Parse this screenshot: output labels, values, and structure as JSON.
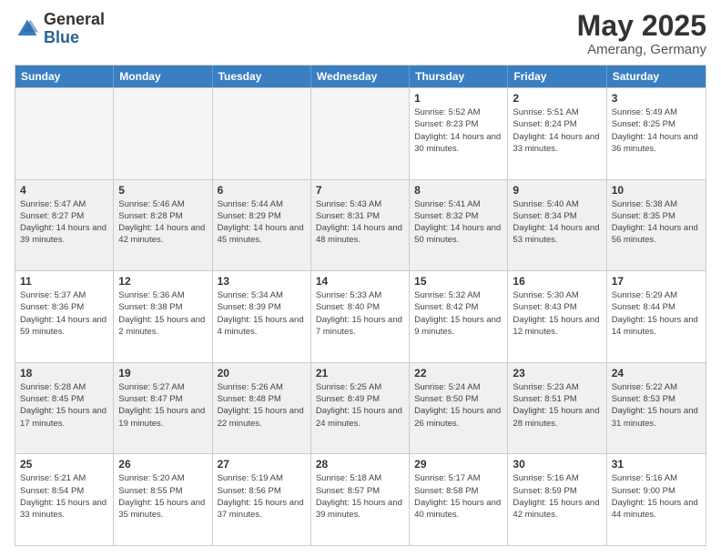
{
  "header": {
    "logo_general": "General",
    "logo_blue": "Blue",
    "month_year": "May 2025",
    "location": "Amerang, Germany"
  },
  "weekdays": [
    "Sunday",
    "Monday",
    "Tuesday",
    "Wednesday",
    "Thursday",
    "Friday",
    "Saturday"
  ],
  "weeks": [
    [
      {
        "day": "",
        "empty": true
      },
      {
        "day": "",
        "empty": true
      },
      {
        "day": "",
        "empty": true
      },
      {
        "day": "",
        "empty": true
      },
      {
        "day": "1",
        "sunrise": "Sunrise: 5:52 AM",
        "sunset": "Sunset: 8:23 PM",
        "daylight": "Daylight: 14 hours and 30 minutes."
      },
      {
        "day": "2",
        "sunrise": "Sunrise: 5:51 AM",
        "sunset": "Sunset: 8:24 PM",
        "daylight": "Daylight: 14 hours and 33 minutes."
      },
      {
        "day": "3",
        "sunrise": "Sunrise: 5:49 AM",
        "sunset": "Sunset: 8:25 PM",
        "daylight": "Daylight: 14 hours and 36 minutes."
      }
    ],
    [
      {
        "day": "4",
        "sunrise": "Sunrise: 5:47 AM",
        "sunset": "Sunset: 8:27 PM",
        "daylight": "Daylight: 14 hours and 39 minutes."
      },
      {
        "day": "5",
        "sunrise": "Sunrise: 5:46 AM",
        "sunset": "Sunset: 8:28 PM",
        "daylight": "Daylight: 14 hours and 42 minutes."
      },
      {
        "day": "6",
        "sunrise": "Sunrise: 5:44 AM",
        "sunset": "Sunset: 8:29 PM",
        "daylight": "Daylight: 14 hours and 45 minutes."
      },
      {
        "day": "7",
        "sunrise": "Sunrise: 5:43 AM",
        "sunset": "Sunset: 8:31 PM",
        "daylight": "Daylight: 14 hours and 48 minutes."
      },
      {
        "day": "8",
        "sunrise": "Sunrise: 5:41 AM",
        "sunset": "Sunset: 8:32 PM",
        "daylight": "Daylight: 14 hours and 50 minutes."
      },
      {
        "day": "9",
        "sunrise": "Sunrise: 5:40 AM",
        "sunset": "Sunset: 8:34 PM",
        "daylight": "Daylight: 14 hours and 53 minutes."
      },
      {
        "day": "10",
        "sunrise": "Sunrise: 5:38 AM",
        "sunset": "Sunset: 8:35 PM",
        "daylight": "Daylight: 14 hours and 56 minutes."
      }
    ],
    [
      {
        "day": "11",
        "sunrise": "Sunrise: 5:37 AM",
        "sunset": "Sunset: 8:36 PM",
        "daylight": "Daylight: 14 hours and 59 minutes."
      },
      {
        "day": "12",
        "sunrise": "Sunrise: 5:36 AM",
        "sunset": "Sunset: 8:38 PM",
        "daylight": "Daylight: 15 hours and 2 minutes."
      },
      {
        "day": "13",
        "sunrise": "Sunrise: 5:34 AM",
        "sunset": "Sunset: 8:39 PM",
        "daylight": "Daylight: 15 hours and 4 minutes."
      },
      {
        "day": "14",
        "sunrise": "Sunrise: 5:33 AM",
        "sunset": "Sunset: 8:40 PM",
        "daylight": "Daylight: 15 hours and 7 minutes."
      },
      {
        "day": "15",
        "sunrise": "Sunrise: 5:32 AM",
        "sunset": "Sunset: 8:42 PM",
        "daylight": "Daylight: 15 hours and 9 minutes."
      },
      {
        "day": "16",
        "sunrise": "Sunrise: 5:30 AM",
        "sunset": "Sunset: 8:43 PM",
        "daylight": "Daylight: 15 hours and 12 minutes."
      },
      {
        "day": "17",
        "sunrise": "Sunrise: 5:29 AM",
        "sunset": "Sunset: 8:44 PM",
        "daylight": "Daylight: 15 hours and 14 minutes."
      }
    ],
    [
      {
        "day": "18",
        "sunrise": "Sunrise: 5:28 AM",
        "sunset": "Sunset: 8:45 PM",
        "daylight": "Daylight: 15 hours and 17 minutes."
      },
      {
        "day": "19",
        "sunrise": "Sunrise: 5:27 AM",
        "sunset": "Sunset: 8:47 PM",
        "daylight": "Daylight: 15 hours and 19 minutes."
      },
      {
        "day": "20",
        "sunrise": "Sunrise: 5:26 AM",
        "sunset": "Sunset: 8:48 PM",
        "daylight": "Daylight: 15 hours and 22 minutes."
      },
      {
        "day": "21",
        "sunrise": "Sunrise: 5:25 AM",
        "sunset": "Sunset: 8:49 PM",
        "daylight": "Daylight: 15 hours and 24 minutes."
      },
      {
        "day": "22",
        "sunrise": "Sunrise: 5:24 AM",
        "sunset": "Sunset: 8:50 PM",
        "daylight": "Daylight: 15 hours and 26 minutes."
      },
      {
        "day": "23",
        "sunrise": "Sunrise: 5:23 AM",
        "sunset": "Sunset: 8:51 PM",
        "daylight": "Daylight: 15 hours and 28 minutes."
      },
      {
        "day": "24",
        "sunrise": "Sunrise: 5:22 AM",
        "sunset": "Sunset: 8:53 PM",
        "daylight": "Daylight: 15 hours and 31 minutes."
      }
    ],
    [
      {
        "day": "25",
        "sunrise": "Sunrise: 5:21 AM",
        "sunset": "Sunset: 8:54 PM",
        "daylight": "Daylight: 15 hours and 33 minutes."
      },
      {
        "day": "26",
        "sunrise": "Sunrise: 5:20 AM",
        "sunset": "Sunset: 8:55 PM",
        "daylight": "Daylight: 15 hours and 35 minutes."
      },
      {
        "day": "27",
        "sunrise": "Sunrise: 5:19 AM",
        "sunset": "Sunset: 8:56 PM",
        "daylight": "Daylight: 15 hours and 37 minutes."
      },
      {
        "day": "28",
        "sunrise": "Sunrise: 5:18 AM",
        "sunset": "Sunset: 8:57 PM",
        "daylight": "Daylight: 15 hours and 39 minutes."
      },
      {
        "day": "29",
        "sunrise": "Sunrise: 5:17 AM",
        "sunset": "Sunset: 8:58 PM",
        "daylight": "Daylight: 15 hours and 40 minutes."
      },
      {
        "day": "30",
        "sunrise": "Sunrise: 5:16 AM",
        "sunset": "Sunset: 8:59 PM",
        "daylight": "Daylight: 15 hours and 42 minutes."
      },
      {
        "day": "31",
        "sunrise": "Sunrise: 5:16 AM",
        "sunset": "Sunset: 9:00 PM",
        "daylight": "Daylight: 15 hours and 44 minutes."
      }
    ]
  ]
}
